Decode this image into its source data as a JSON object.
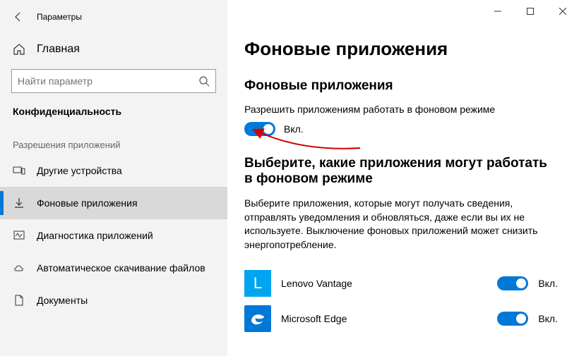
{
  "window": {
    "title": "Параметры"
  },
  "sidebar": {
    "home": "Главная",
    "search_placeholder": "Найти параметр",
    "group": "Конфиденциальность",
    "section": "Разрешения приложений",
    "items": [
      {
        "label": "Другие устройства"
      },
      {
        "label": "Фоновые приложения"
      },
      {
        "label": "Диагностика приложений"
      },
      {
        "label": "Автоматическое скачивание файлов"
      },
      {
        "label": "Документы"
      }
    ]
  },
  "page": {
    "heading": "Фоновые приложения",
    "sub1": "Фоновые приложения",
    "allow_text": "Разрешить приложениям работать в фоновом режиме",
    "toggle_on": "Вкл.",
    "sub2": "Выберите, какие приложения могут работать в фоновом режиме",
    "body": "Выберите приложения, которые могут получать сведения, отправлять уведомления и обновляться, даже если вы их не используете. Выключение фоновых приложений может снизить энергопотребление.",
    "apps": [
      {
        "name": "Lenovo Vantage",
        "state": "Вкл."
      },
      {
        "name": "Microsoft Edge",
        "state": "Вкл."
      }
    ]
  }
}
